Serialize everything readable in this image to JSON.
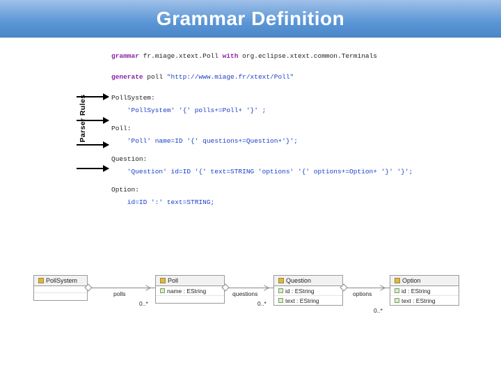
{
  "title": "Grammar Definition",
  "rules_label": "Parser Rules",
  "code": {
    "l1_kw": "grammar",
    "l1_rest": " fr.miage.xtext.Poll ",
    "l1_with": "with",
    "l1_rest2": " org.eclipse.xtext.common.Terminals",
    "l2_kw": "generate",
    "l2_rest": " poll ",
    "l2_str": "\"http://www.miage.fr/xtext/Poll\"",
    "r1_name": "PollSystem:",
    "r1_body": "    'PollSystem' '{' polls+=Poll+ '}' ;",
    "r2_name": "Poll:",
    "r2_body": "    'Poll' name=ID '{' questions+=Question+'}';",
    "r3_name": "Question:",
    "r3_body": "    'Question' id=ID '{' text=STRING 'options' '{' options+=Option+ '}' '}';",
    "r4_name": "Option:",
    "r4_body": "    id=ID ':' text=STRING;"
  },
  "uml": {
    "c1": "PollSystem",
    "c2": "Poll",
    "c2_a1": "name : EString",
    "c3": "Question",
    "c3_a1": "id : EString",
    "c3_a2": "text : EString",
    "c4": "Option",
    "c4_a1": "id : EString",
    "c4_a2": "text : EString",
    "assoc1": "polls",
    "assoc2": "questions",
    "assoc3": "options",
    "mult": "0..*"
  }
}
